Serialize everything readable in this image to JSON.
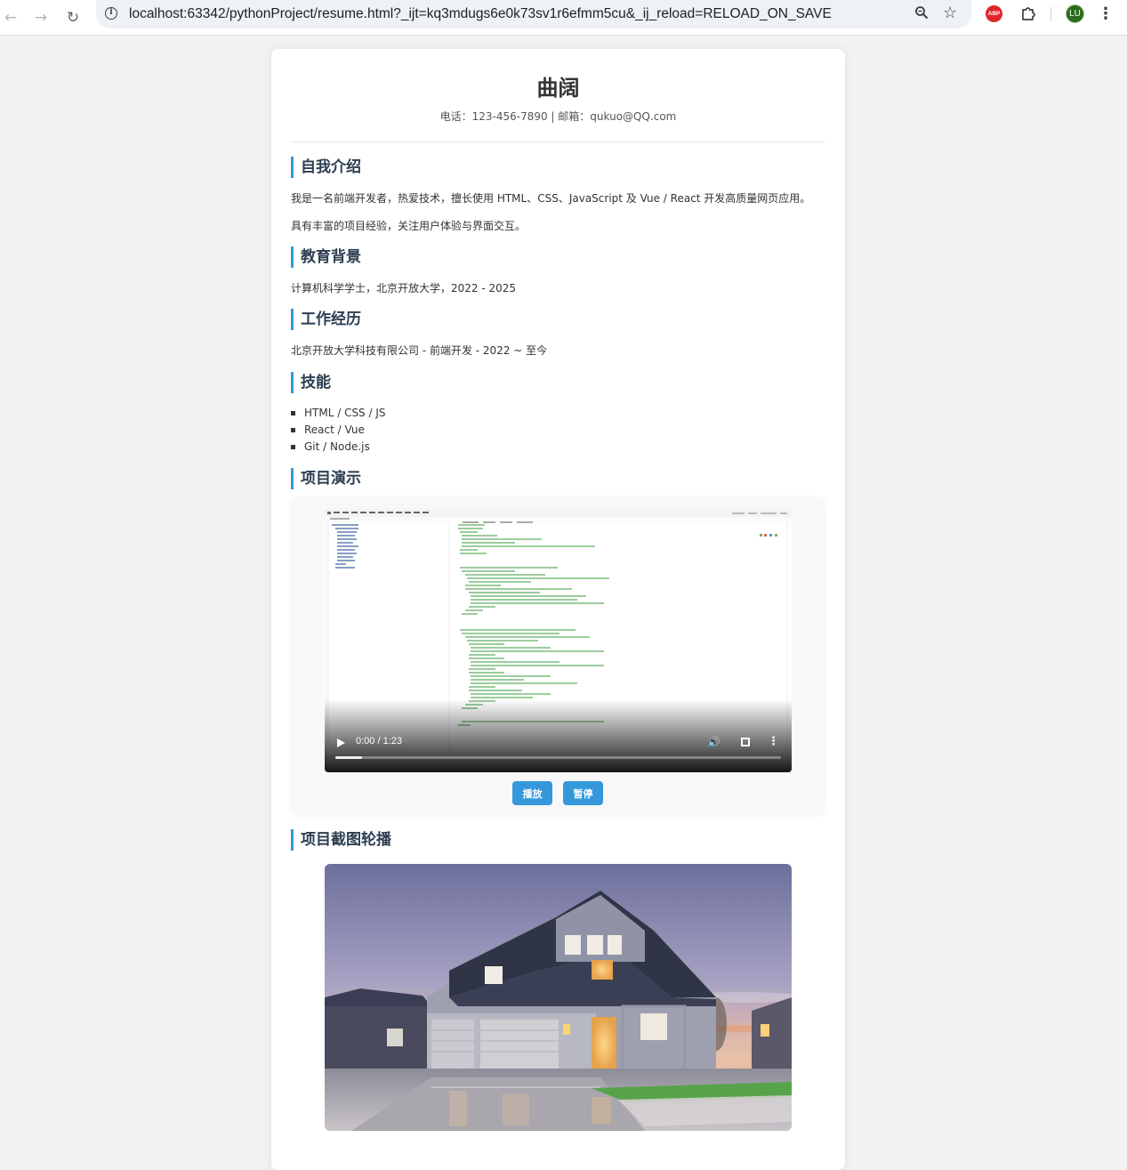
{
  "browser": {
    "url": "localhost:63342/pythonProject/resume.html?_ijt=kq3mdugs6e0k73sv1r6efmm5cu&_ij_reload=RELOAD_ON_SAVE",
    "abp_label": "ABP",
    "profile_initials": "LU"
  },
  "resume": {
    "name": "曲阔",
    "contact": "电话：123-456-7890 | 邮箱：qukuo@QQ.com",
    "sections": {
      "intro": {
        "title": "自我介绍",
        "paragraphs": [
          "我是一名前端开发者，热爱技术，擅长使用 HTML、CSS、JavaScript 及 Vue / React 开发高质量网页应用。",
          "具有丰富的项目经验，关注用户体验与界面交互。"
        ]
      },
      "education": {
        "title": "教育背景",
        "text": "计算机科学学士，北京开放大学，2022 - 2025"
      },
      "work": {
        "title": "工作经历",
        "text": "北京开放大学科技有限公司 - 前端开发 - 2022 ~ 至今"
      },
      "skills": {
        "title": "技能",
        "items": [
          "HTML / CSS / JS",
          "React / Vue",
          "Git / Node.js"
        ]
      },
      "demo": {
        "title": "项目演示",
        "video_time": "0:00 / 1:23",
        "video_progress": 0.06,
        "play_label": "播放",
        "pause_label": "暂停"
      },
      "carousel": {
        "title": "项目截图轮播"
      }
    }
  },
  "colors": {
    "accent": "#3498db",
    "heading": "#2c3e50",
    "page_bg": "#f2f2f2"
  }
}
